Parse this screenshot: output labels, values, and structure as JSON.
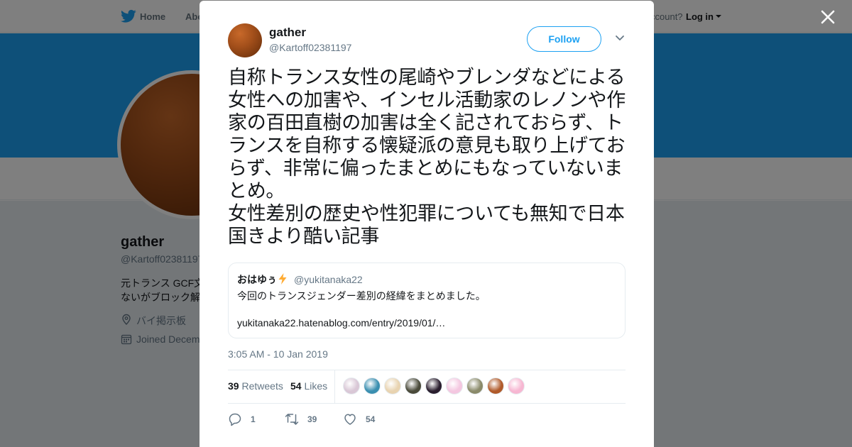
{
  "nav": {
    "home_label": "Home",
    "about_label": "Abo",
    "account_prompt": "ccount?",
    "login_label": "Log in"
  },
  "profile": {
    "name": "gather",
    "handle": "@Kartoff02381197",
    "bio_line1": "元トランス GCF文",
    "bio_line2": "ないがブロック解",
    "location": "バイ掲示板",
    "joined": "Joined Decem"
  },
  "tweet": {
    "author_name": "gather",
    "author_handle": "@Kartoff02381197",
    "follow_label": "Follow",
    "text": "自称トランス女性の尾崎やブレンダなどによる女性への加害や、インセル活動家のレノンや作家の百田直樹の加害は全く記されておらず、トランスを自称する懐疑派の意見も取り上げておらず、非常に偏ったまとめにもなっていないまとめ。\n女性差別の歴史や性犯罪についても無知で日本国きより酷い記事",
    "timestamp": "3:05 AM - 10 Jan 2019",
    "quoted": {
      "name": "おはゆぅ",
      "handle": "@yukitanaka22",
      "text": "今回のトランスジェンダー差別の経緯をまとめました。",
      "link": "yukitanaka22.hatenablog.com/entry/2019/01/…"
    },
    "stats": {
      "retweets_count": "39",
      "retweets_label": "Retweets",
      "likes_count": "54",
      "likes_label": "Likes"
    },
    "actions": {
      "reply_count": "1",
      "retweet_count": "39",
      "like_count": "54"
    },
    "liker_colors": [
      "#d9c7d6",
      "#3a8fb0",
      "#e8d3b0",
      "#4a4a3a",
      "#2a1e2e",
      "#f4c7e0",
      "#8a8a6a",
      "#b05a2a",
      "#f7b7d2"
    ]
  },
  "colors": {
    "brand": "#1da1f2",
    "text_primary": "#14171a",
    "text_secondary": "#657786",
    "border": "#e6ecf0"
  }
}
